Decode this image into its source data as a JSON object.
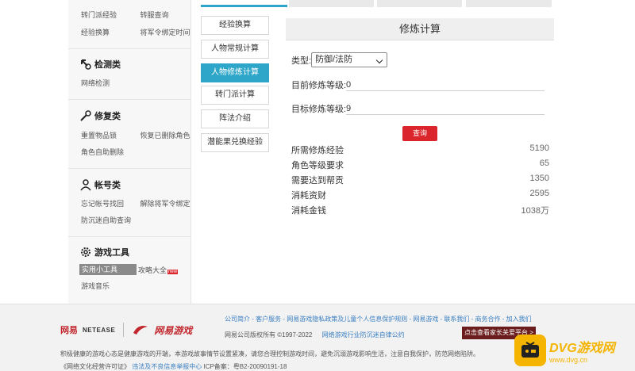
{
  "sidebar": {
    "top_rows": [
      [
        "转门派经验",
        "转服查询"
      ],
      [
        "经验换算",
        "将军令绑定时间"
      ]
    ],
    "sections": [
      {
        "title": "检测类",
        "icon": "magnifier-icon",
        "rows": [
          [
            "网络检测",
            ""
          ]
        ]
      },
      {
        "title": "修复类",
        "icon": "wrench-icon",
        "rows": [
          [
            "重置物品锁",
            "恢复已删除角色"
          ],
          [
            "角色自助删除",
            ""
          ]
        ]
      },
      {
        "title": "帐号类",
        "icon": "person-icon",
        "rows": [
          [
            "忘记帐号找回",
            "解除将军令绑定"
          ],
          [
            "防沉迷自助查询",
            ""
          ]
        ]
      },
      {
        "title": "游戏工具",
        "icon": "gear-icon",
        "rows": [
          [
            "实用小工具",
            "攻略大全"
          ],
          [
            "游戏音乐",
            ""
          ]
        ]
      }
    ],
    "new_badge": "new"
  },
  "mid_tabs": [
    {
      "label": "经验换算",
      "active": false
    },
    {
      "label": "人物常规计算",
      "active": false
    },
    {
      "label": "人物修炼计算",
      "active": true
    },
    {
      "label": "转门派计算",
      "active": false
    },
    {
      "label": "阵法介绍",
      "active": false
    },
    {
      "label": "潜能果兑换经验",
      "active": false
    }
  ],
  "panel": {
    "title": "修炼计算",
    "type_label": "类型:",
    "type_value": "防御/法防",
    "current_label": "目前修炼等级:",
    "current_value": "0",
    "target_label": "目标修炼等级:",
    "target_value": "9",
    "query_button": "查询",
    "results": [
      {
        "label": "所需修炼经验",
        "value": "5190"
      },
      {
        "label": "角色等级要求",
        "value": "65"
      },
      {
        "label": "需要达到帮贡",
        "value": "1350"
      },
      {
        "label": "消耗资财",
        "value": "2595"
      },
      {
        "label": "消耗金钱",
        "value": "1038万"
      }
    ]
  },
  "footer": {
    "links": "公司简介 - 客户服务 - 网易游戏隐私政策及儿童个人信息保护规则 - 网易游戏 - 联系我们 - 商务合作 - 加入我们",
    "copyright": "网易公司版权所有 ©1997-2022",
    "self_discipline": "网络游戏行业防沉迷自律公约",
    "logo_netease": "网易",
    "logo_netease_en": "NETEASE",
    "logo_game": "网易游戏",
    "parent_platform": "点击查看家长关爱平台 >",
    "notice": "积极健康的游戏心态是健康游戏的开端，本游戏故事情节设置紧凑，请您合理控制游戏时间，避免沉溺游戏影响生活，注意自我保护，防范网络陷阱。",
    "license_prefix": "《网络文化经营许可证》",
    "license_link": "违法及不良信息举报中心",
    "icp": "ICP备案：粤B2-20090191-18",
    "watermark": "DVG游戏网",
    "watermark_sub": "www.dvg.cn"
  }
}
